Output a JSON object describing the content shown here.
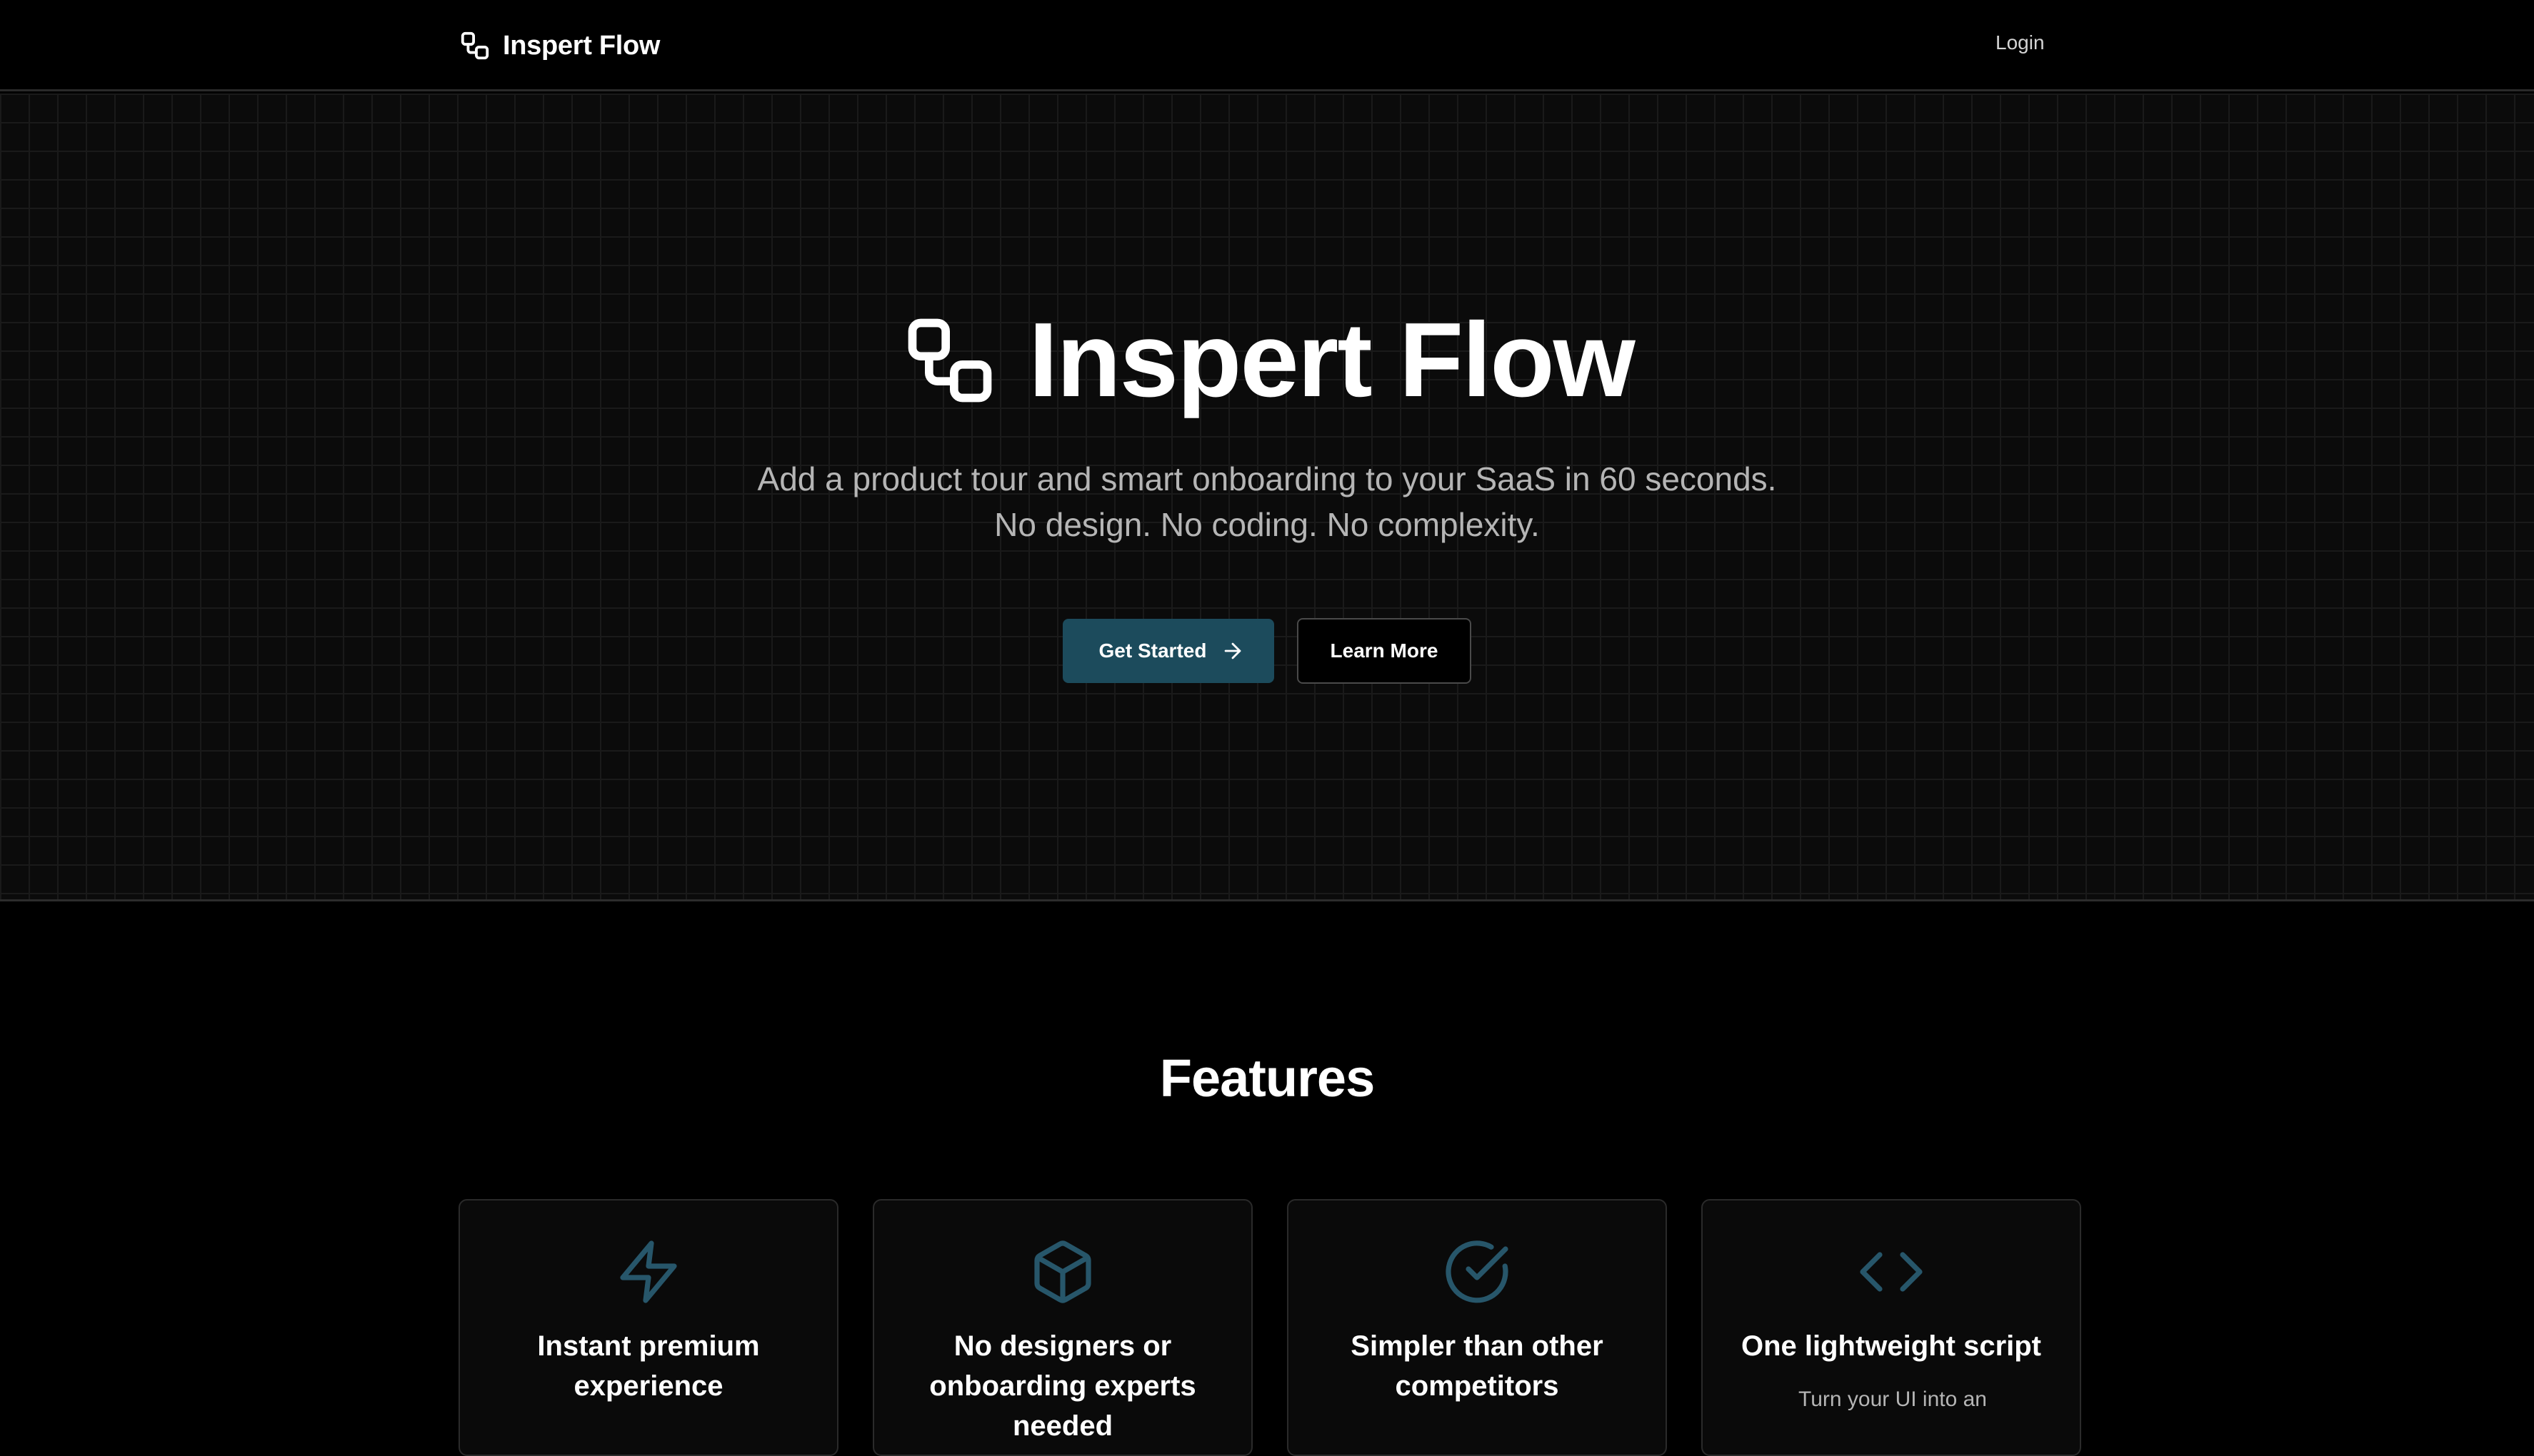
{
  "header": {
    "brand_name": "Inspert Flow",
    "login_label": "Login"
  },
  "hero": {
    "title": "Inspert Flow",
    "subtitle_line1": "Add a product tour and smart onboarding to your SaaS in 60 seconds.",
    "subtitle_line2": "No design. No coding. No complexity.",
    "primary_button_label": "Get Started",
    "secondary_button_label": "Learn More"
  },
  "features": {
    "title": "Features",
    "items": [
      {
        "icon": "lightning-icon",
        "title": "Instant premium experience",
        "description": ""
      },
      {
        "icon": "cube-icon",
        "title": "No designers or onboarding experts needed",
        "description": ""
      },
      {
        "icon": "check-circle-icon",
        "title": "Simpler than other competitors",
        "description": ""
      },
      {
        "icon": "code-icon",
        "title": "One lightweight script",
        "description": "Turn your UI into an"
      }
    ]
  },
  "colors": {
    "background": "#000000",
    "hero_background": "#0b0b0b",
    "accent": "#1c4b5c",
    "icon_accent": "#27566a",
    "muted_text": "#b5b5b5"
  }
}
